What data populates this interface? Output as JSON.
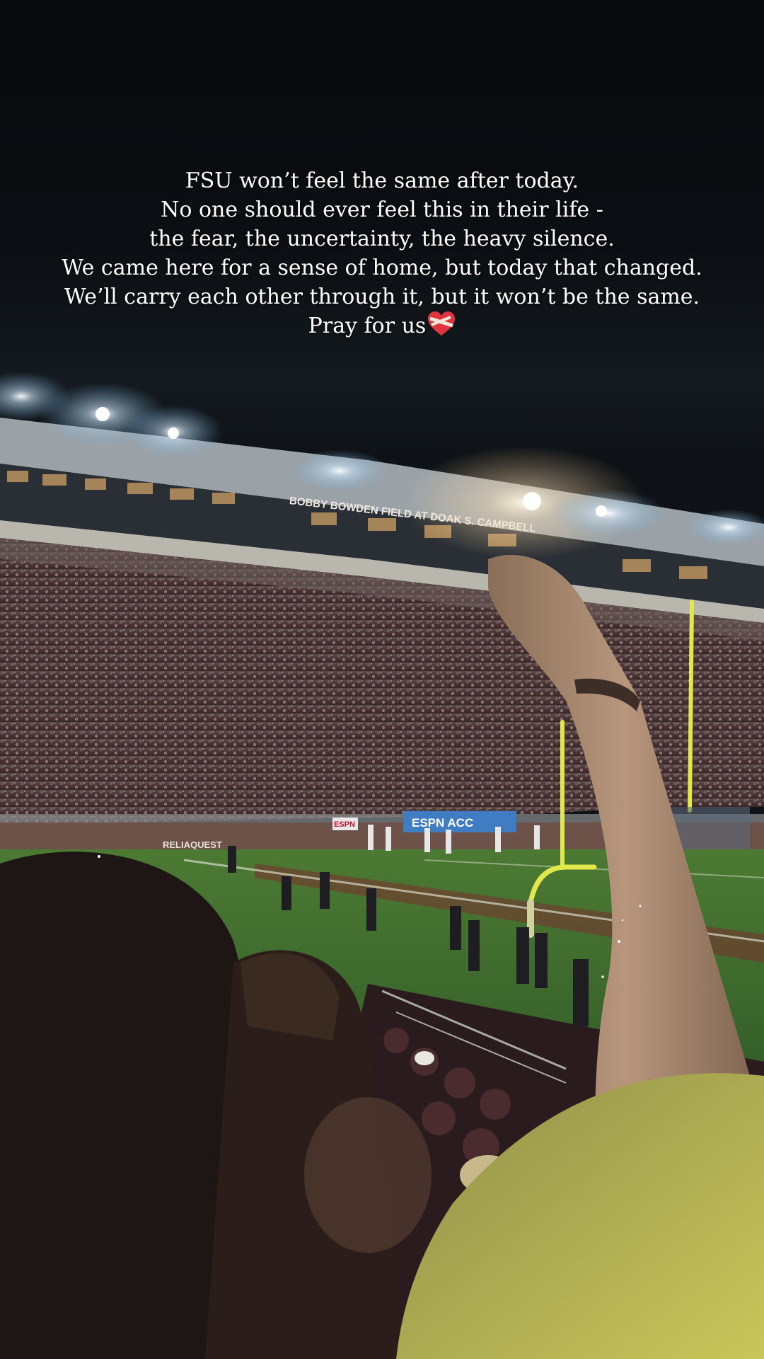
{
  "caption": {
    "lines": [
      "FSU won’t feel the same after today.",
      "No one should ever feel this in their life -",
      "the fear, the uncertainty, the heavy silence.",
      "We came here for a sense of home, but today that changed.",
      "We’ll carry each other through it, but it won’t be the same."
    ],
    "last_line": "Pray for us",
    "emoji": "mending-heart-icon"
  },
  "stadium": {
    "facade_sign": "BOBBY BOWDEN FIELD AT DOAK S. CAMPBELL",
    "wall_sign": "RELIAQUEST",
    "board_sign_1": "ESPN",
    "board_sign_2": "ESPN ACC"
  },
  "colors": {
    "field": "#3f6b2e",
    "goalpost": "#e2e84a",
    "crowd": "#3a2a2c",
    "sky": "#0b0e12"
  }
}
